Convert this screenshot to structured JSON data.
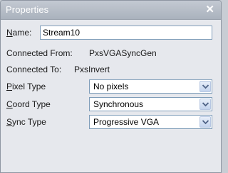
{
  "window": {
    "title": "Properties",
    "close_glyph": "✕"
  },
  "name": {
    "label": "Name:",
    "value": "Stream10"
  },
  "connected_from": {
    "label": "Connected From:",
    "value": "PxsVGASyncGen"
  },
  "connected_to": {
    "label": "Connected To:",
    "value": "PxsInvert"
  },
  "pixel_type": {
    "label": "Pixel Type",
    "value": "No pixels"
  },
  "coord_type": {
    "label": "Coord Type",
    "value": "Synchronous"
  },
  "sync_type": {
    "label": "Sync Type",
    "value": "Progressive VGA"
  },
  "icons": {
    "close": "close-icon",
    "dropdown": "chevron-down-icon"
  },
  "colors": {
    "title_bar": "#aab2bd",
    "dialog_bg": "#e6e8ed",
    "input_border": "#7f9db9",
    "dropdown_arrow": "#4d6185"
  }
}
